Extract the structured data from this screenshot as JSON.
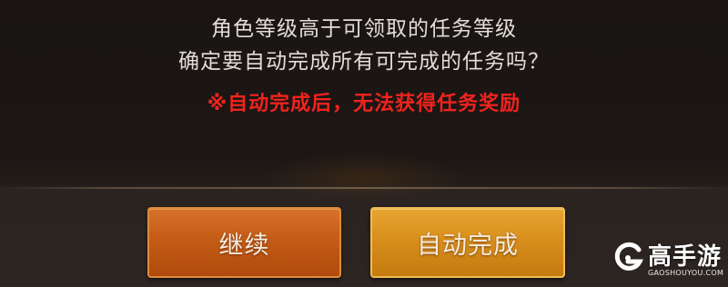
{
  "dialog": {
    "message_line1": "角色等级高于可领取的任务等级",
    "message_line2": "确定要自动完成所有可完成的任务吗？",
    "warning": "※自动完成后，无法获得任务奖励"
  },
  "buttons": {
    "continue_label": "继续",
    "auto_complete_label": "自动完成"
  },
  "watermark": {
    "title": "高手游",
    "subtitle": "GAOSHOUYOU.COM"
  },
  "colors": {
    "message_text": "#e2ddd6",
    "warning_text": "#f0231d",
    "continue_button": "#c65e18",
    "auto_complete_button": "#d88f1c",
    "background": "#1c1715"
  }
}
